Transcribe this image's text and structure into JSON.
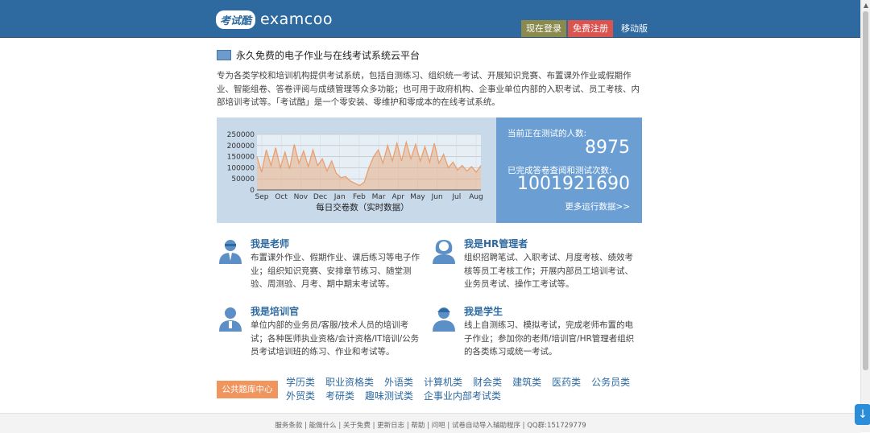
{
  "header": {
    "logo_badge": "考试酷",
    "logo_text": "examcoo",
    "login_label": "现在登录",
    "register_label": "免费注册",
    "mobile_label": "移动版"
  },
  "tagline": "永久免费的电子作业与在线考试系统云平台",
  "intro": "专为各类学校和培训机构提供考试系统，包括自测练习、组织统一考试、开展知识竞赛、布置课外作业或假期作业、智能组卷、答卷评阅与成绩管理等众多功能；也可用于政府机构、企事业单位内部的入职考试、员工考核、内部培训考试等。「考试酷」是一个零安装、零维护和零成本的在线考试系统。",
  "stats": {
    "label_current": "当前正在测试的人数:",
    "value_current": "8975",
    "label_total": "已完成答卷查阅和测试次数:",
    "value_total": "1001921690",
    "more_link": "更多运行数据>>"
  },
  "chart_data": {
    "type": "area",
    "title": "每日交卷数（实时数据）",
    "xlabel": "",
    "ylabel": "",
    "x_ticks": [
      "Sep",
      "Oct",
      "Nov",
      "Dec",
      "Jan",
      "Feb",
      "Mar",
      "Apr",
      "May",
      "Jun",
      "Jul",
      "Aug"
    ],
    "y_ticks": [
      "250000",
      "200000",
      "150000",
      "100000",
      "50000",
      "0"
    ],
    "ylim": [
      0,
      250000
    ],
    "grid": true,
    "series": [
      {
        "color": "#e8a06e",
        "values": [
          150000,
          80000,
          180000,
          110000,
          190000,
          100000,
          170000,
          95000,
          205000,
          120000,
          175000,
          105000,
          180000,
          110000,
          140000,
          85000,
          130000,
          75000,
          55000,
          60000,
          40000,
          30000,
          20000,
          35000,
          100000,
          150000,
          180000,
          120000,
          200000,
          130000,
          210000,
          130000,
          215000,
          140000,
          205000,
          130000,
          195000,
          125000,
          210000,
          120000,
          160000,
          100000,
          125000,
          90000,
          110000,
          85000,
          105000,
          80000,
          110000
        ]
      }
    ]
  },
  "roles": [
    {
      "title": "我是老师",
      "desc": "布置课外作业、假期作业、课后练习等电子作业；组织知识竞赛、安排章节练习、随堂测验、周测验、月考、期中期末考试等。"
    },
    {
      "title": "我是HR管理者",
      "desc": "组织招聘笔试、入职考试、月度考核、绩效考核等员工考核工作；开展内部员工培训考试、业务员考试、操作工考试等。"
    },
    {
      "title": "我是培训官",
      "desc": "单位内部的业务员/客服/技术人员的培训考试；各种医师执业资格/会计资格/IT培训/公务员考试培训班的练习、作业和考试等。"
    },
    {
      "title": "我是学生",
      "desc": "线上自测练习、模拟考试，完成老师布置的电子作业；参加你的老师/培训官/HR管理者组织的各类练习或统一考试。"
    }
  ],
  "categories": {
    "label": "公共题库中心",
    "items": [
      "学历类",
      "职业资格类",
      "外语类",
      "计算机类",
      "财会类",
      "建筑类",
      "医药类",
      "公务员类",
      "外贸类",
      "考研类",
      "趣味测试类",
      "企事业内部考试类"
    ]
  },
  "footer": "服务条款 | 能做什么 | 关于免费 | 更新日志 | 帮助 | 问吧 | 试卷自动导入辅助程序 | QQ群:151729779",
  "float_button": "↓",
  "scrollbar": {
    "up": "▲",
    "down": "▼"
  }
}
